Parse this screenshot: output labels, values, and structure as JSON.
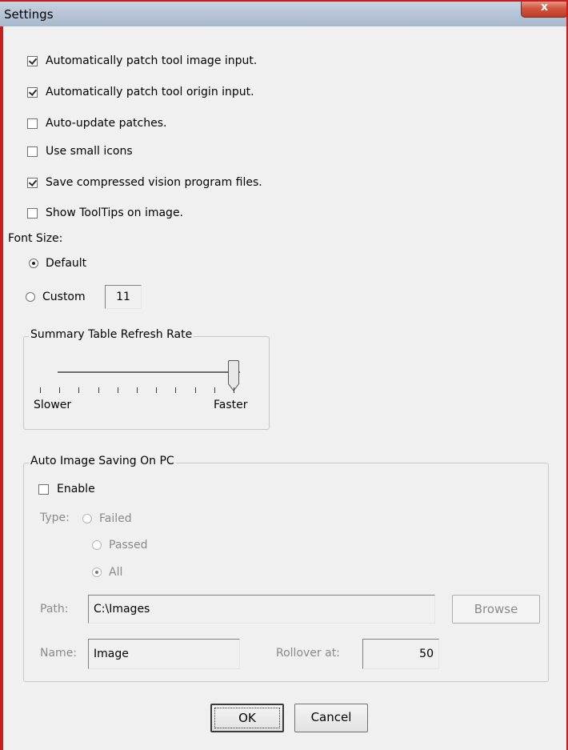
{
  "window": {
    "title": "Settings",
    "close_glyph": "x"
  },
  "options": [
    {
      "label": "Automatically patch tool image input.",
      "checked": true
    },
    {
      "label": "Automatically patch tool origin input.",
      "checked": true
    },
    {
      "label": "Auto-update patches.",
      "checked": false
    },
    {
      "label": "Use small icons",
      "checked": false
    },
    {
      "label": "Save compressed vision program files.",
      "checked": true
    },
    {
      "label": "Show ToolTips on image.",
      "checked": false
    }
  ],
  "font_size": {
    "label": "Font Size:",
    "default_label": "Default",
    "custom_label": "Custom",
    "custom_value": "11",
    "selected": "Default"
  },
  "refresh": {
    "title": "Summary Table Refresh Rate",
    "min_label": "Slower",
    "max_label": "Faster",
    "position_fraction": 1.0,
    "tick_count": 11
  },
  "auto_save": {
    "title": "Auto Image Saving On PC",
    "enable_label": "Enable",
    "enabled": false,
    "type_label": "Type:",
    "type_options": [
      "Failed",
      "Passed",
      "All"
    ],
    "type_selected": "All",
    "path_label": "Path:",
    "path_value": "C:\\Images",
    "browse_label": "Browse",
    "name_label": "Name:",
    "name_value": "Image",
    "rollover_label": "Rollover at:",
    "rollover_value": "50"
  },
  "buttons": {
    "ok": "OK",
    "cancel": "Cancel"
  },
  "colors": {
    "frame_accent": "#c81e1e",
    "dialog_bg": "#f0f0f0"
  }
}
